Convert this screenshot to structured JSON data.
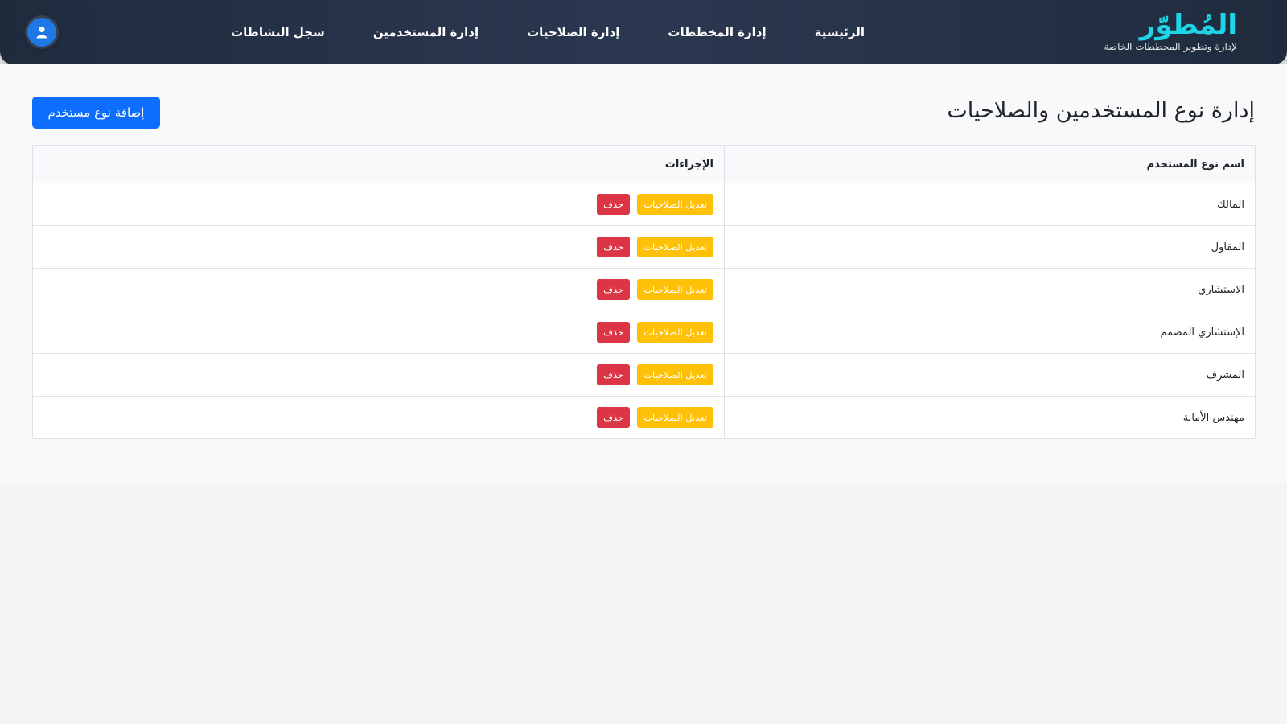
{
  "brand": {
    "name": "المُطوّر",
    "tagline": "لإدارة وتطوير المخططات الخاصة",
    "accent_color": "#1ed4e6"
  },
  "nav": {
    "items": [
      {
        "label": "الرئيسية"
      },
      {
        "label": "إدارة المخططات"
      },
      {
        "label": "إدارة الصلاحيات"
      },
      {
        "label": "إدارة المستخدمين"
      },
      {
        "label": "سجل النشاطات"
      }
    ],
    "user_icon": "user-icon"
  },
  "page": {
    "title": "إدارة نوع المستخدمين والصلاحيات",
    "add_button_label": "إضافة نوع مستخدم"
  },
  "table": {
    "headers": {
      "name": "اسم نوع المستخدم",
      "actions": "الإجراءات"
    },
    "edit_label": "تعديل الصلاحيات",
    "delete_label": "حذف",
    "rows": [
      {
        "name": "المالك"
      },
      {
        "name": "المقاول"
      },
      {
        "name": "الاستشاري"
      },
      {
        "name": "الإستشاري المصمم"
      },
      {
        "name": "المشرف"
      },
      {
        "name": "مهندس الأمانة"
      }
    ]
  },
  "colors": {
    "primary": "#0d6efd",
    "warning": "#ffc107",
    "danger": "#dc3545",
    "navbar": "#263349"
  }
}
